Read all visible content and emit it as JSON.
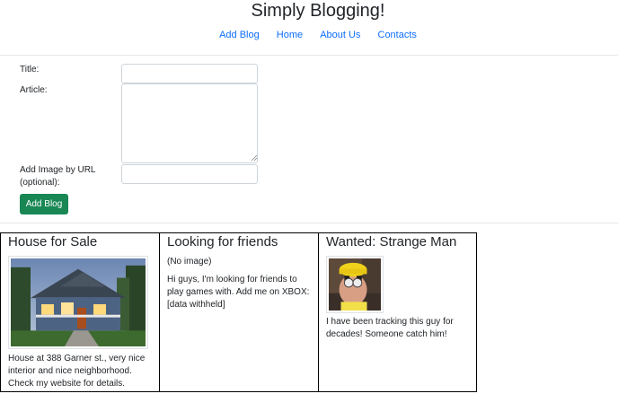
{
  "header": {
    "title": "Simply Blogging!"
  },
  "nav": [
    {
      "label": "Add Blog"
    },
    {
      "label": "Home"
    },
    {
      "label": "About Us"
    },
    {
      "label": "Contacts"
    }
  ],
  "form": {
    "title_label": "Title:",
    "title_value": "",
    "article_label": "Article:",
    "article_value": "",
    "image_label": "Add Image by URL (optional):",
    "image_value": "",
    "submit_label": "Add Blog"
  },
  "posts": [
    {
      "title": "House for Sale",
      "image": "house-photo",
      "body": "House at 388 Garner st., very nice interior and nice neighborhood. Check my website for details."
    },
    {
      "title": "Looking for friends",
      "image_note": "(No image)",
      "body": "Hi guys, I'm looking for friends to play games with. Add me on XBOX: [data withheld]"
    },
    {
      "title": "Wanted: Strange Man",
      "image": "man-photo",
      "body": "I have been tracking this guy for decades! Someone catch him!"
    }
  ],
  "colors": {
    "link": "#0d6efd",
    "button": "#198754",
    "border": "#000000"
  }
}
